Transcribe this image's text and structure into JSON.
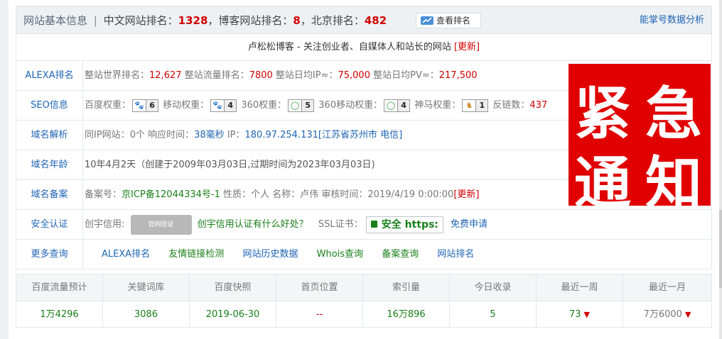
{
  "header": {
    "site_info_label": "网站基本信息",
    "sep": "|",
    "cn_rank_label": "中文网站排名：",
    "cn_rank": "1328",
    "blog_rank_label": "，博客网站排名：",
    "blog_rank": "8",
    "bj_rank_label": "，北京排名：",
    "bj_rank": "482",
    "view_rank_button": "查看排名",
    "right_link": "能掌号数据分析"
  },
  "title_row": {
    "text": "卢松松博客 - 关注创业者、自媒体人和站长的网站",
    "update": "[更新]"
  },
  "rows": {
    "alexa": {
      "label": "ALEXA排名",
      "world_label": "整站世界排名：",
      "world": "12,627",
      "traffic_label": "整站流量排名：",
      "traffic": "7800",
      "ip_label": "整站日均IP≈：",
      "ip": "75,000",
      "pv_label": "整站日均PV≈：",
      "pv": "217,500"
    },
    "seo": {
      "label": "SEO信息",
      "baidu_label": "百度权重：",
      "baidu": "6",
      "mobile_label": "移动权重：",
      "mobile": "4",
      "s360_label": "360权重：",
      "s360": "5",
      "s360m_label": "360移动权重：",
      "s360m": "4",
      "shenma_label": "神马权重：",
      "shenma": "1",
      "backlink_label": "反链数：",
      "backlink": "437"
    },
    "domain": {
      "label": "域名解析",
      "ip_sites_label": "同IP网站：",
      "ip_sites": "0个",
      "resp_label": "响应时间：",
      "resp": "38毫秒",
      "ip_label": "IP：",
      "ip": "180.97.254.131[江苏省苏州市 电信]"
    },
    "age": {
      "label": "域名年龄",
      "text": "10年4月2天（创建于2009年03月03日,过期时间为2023年03月03日)"
    },
    "icp": {
      "label": "域名备案",
      "no_label": "备案号：",
      "no": "京ICP备12044334号-1",
      "nature_label": "性质：",
      "nature": "个人",
      "name_label": "名称：",
      "name": "卢伟",
      "time_label": "审核时间：",
      "time": "2019/4/19 0:00:00",
      "update": "[更新]"
    },
    "security": {
      "label": "安全认证",
      "chuangyu_label": "创宇信用:",
      "seal_text": "官网验证",
      "chuangyu_link": "创宇信用认证有什么好处？",
      "ssl_label": "SSL证书：",
      "https_badge": "安全 https:",
      "free_link": "免费申请"
    },
    "more": {
      "label": "更多查询",
      "links": [
        "ALEXA排名",
        "友情链接检测",
        "网站历史数据",
        "Whois查询",
        "备案查询",
        "网站排名"
      ]
    }
  },
  "alert": {
    "chars": [
      "紧",
      "急",
      "通",
      "知"
    ],
    "color": "#e00000"
  },
  "stats": {
    "headers": [
      "百度流量预计",
      "关键词库",
      "百度快照",
      "首页位置",
      "索引量",
      "今日收录",
      "最近一周",
      "最近一月"
    ],
    "values": [
      "1万4296",
      "3086",
      "2019-06-30",
      "--",
      "16万896",
      "5",
      "73",
      "7万6000"
    ]
  },
  "colors": {
    "accent": "#1e64b4",
    "red": "#d10000",
    "green": "#1a7f1a"
  }
}
